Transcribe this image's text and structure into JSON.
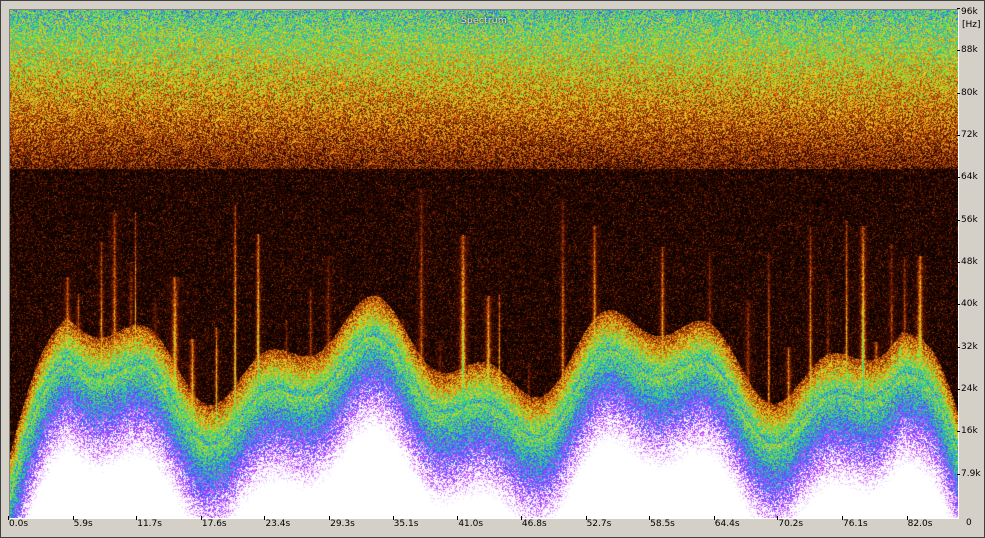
{
  "window": {
    "overlay_title": "Spectrum",
    "frame_color": "#d4d0c8"
  },
  "chart_data": {
    "type": "heatmap",
    "title": "",
    "xlabel": "",
    "ylabel": "",
    "y_unit": "[Hz]",
    "x_range_s": [
      0,
      86.5
    ],
    "y_range_hz": [
      0,
      96000
    ],
    "x_ticks": [
      "0.0s",
      "5.9s",
      "11.7s",
      "17.6s",
      "23.4s",
      "29.3s",
      "35.1s",
      "41.0s",
      "46.8s",
      "52.7s",
      "58.5s",
      "64.4s",
      "70.2s",
      "76.1s",
      "82.0s"
    ],
    "x_tick_values": [
      0.0,
      5.9,
      11.7,
      17.6,
      23.4,
      29.3,
      35.1,
      41.0,
      46.8,
      52.7,
      58.5,
      64.4,
      70.2,
      76.1,
      82.0
    ],
    "y_ticks": [
      "96k",
      "88k",
      "80k",
      "72k",
      "64k",
      "56k",
      "48k",
      "40k",
      "32k",
      "24k",
      "16k",
      "7.9k"
    ],
    "y_tick_values": [
      96000,
      88000,
      80000,
      72000,
      64000,
      56000,
      48000,
      40000,
      32000,
      24000,
      16000,
      7900
    ],
    "y_zero_label": "0",
    "colormap": [
      "#000000",
      "#3a0a00",
      "#8a2a00",
      "#d86a10",
      "#f0d020",
      "#60e040",
      "#20c0c0",
      "#4050ff",
      "#c040ff",
      "#ffffff"
    ],
    "noise_floor_top_hz": 66000,
    "loud_band_top_hz": 24000,
    "transient_times_s": [
      5.2,
      6.2,
      7.0,
      8.3,
      9.5,
      11.0,
      11.4,
      13.2,
      15.0,
      16.6,
      18.8,
      20.5,
      22.6,
      25.2,
      27.4,
      29.0,
      31.4,
      33.6,
      35.8,
      37.5,
      39.2,
      41.3,
      43.6,
      44.6,
      47.3,
      50.4,
      53.3,
      55.0,
      57.5,
      59.5,
      61.4,
      63.8,
      65.5,
      67.3,
      69.2,
      71.0,
      73.0,
      74.6,
      76.3,
      77.8,
      79.0,
      80.4,
      81.6,
      83.0
    ]
  }
}
